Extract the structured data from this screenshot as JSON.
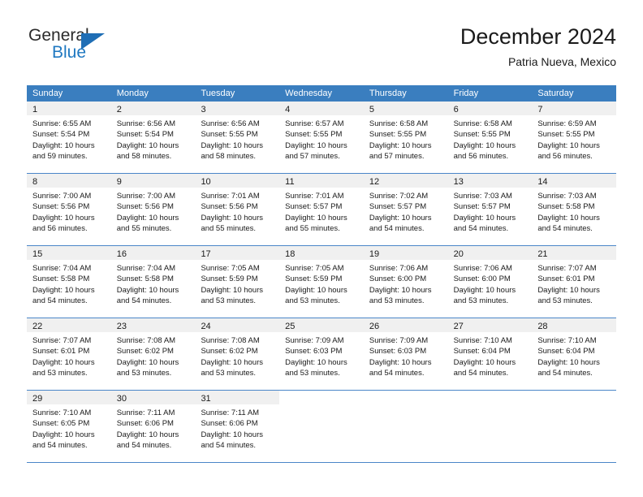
{
  "brand": {
    "name_line1": "General",
    "name_line2": "Blue",
    "accent_color": "#1f78c1",
    "logo_triangle_color": "#1f6eb5"
  },
  "header": {
    "month_title": "December 2024",
    "location": "Patria Nueva, Mexico"
  },
  "calendar": {
    "header_bg": "#3a7ebf",
    "day_band_bg": "#f0f0f0",
    "weekdays": [
      "Sunday",
      "Monday",
      "Tuesday",
      "Wednesday",
      "Thursday",
      "Friday",
      "Saturday"
    ],
    "weeks": [
      [
        {
          "day": "1",
          "sunrise": "Sunrise: 6:55 AM",
          "sunset": "Sunset: 5:54 PM",
          "daylight1": "Daylight: 10 hours",
          "daylight2": "and 59 minutes."
        },
        {
          "day": "2",
          "sunrise": "Sunrise: 6:56 AM",
          "sunset": "Sunset: 5:54 PM",
          "daylight1": "Daylight: 10 hours",
          "daylight2": "and 58 minutes."
        },
        {
          "day": "3",
          "sunrise": "Sunrise: 6:56 AM",
          "sunset": "Sunset: 5:55 PM",
          "daylight1": "Daylight: 10 hours",
          "daylight2": "and 58 minutes."
        },
        {
          "day": "4",
          "sunrise": "Sunrise: 6:57 AM",
          "sunset": "Sunset: 5:55 PM",
          "daylight1": "Daylight: 10 hours",
          "daylight2": "and 57 minutes."
        },
        {
          "day": "5",
          "sunrise": "Sunrise: 6:58 AM",
          "sunset": "Sunset: 5:55 PM",
          "daylight1": "Daylight: 10 hours",
          "daylight2": "and 57 minutes."
        },
        {
          "day": "6",
          "sunrise": "Sunrise: 6:58 AM",
          "sunset": "Sunset: 5:55 PM",
          "daylight1": "Daylight: 10 hours",
          "daylight2": "and 56 minutes."
        },
        {
          "day": "7",
          "sunrise": "Sunrise: 6:59 AM",
          "sunset": "Sunset: 5:55 PM",
          "daylight1": "Daylight: 10 hours",
          "daylight2": "and 56 minutes."
        }
      ],
      [
        {
          "day": "8",
          "sunrise": "Sunrise: 7:00 AM",
          "sunset": "Sunset: 5:56 PM",
          "daylight1": "Daylight: 10 hours",
          "daylight2": "and 56 minutes."
        },
        {
          "day": "9",
          "sunrise": "Sunrise: 7:00 AM",
          "sunset": "Sunset: 5:56 PM",
          "daylight1": "Daylight: 10 hours",
          "daylight2": "and 55 minutes."
        },
        {
          "day": "10",
          "sunrise": "Sunrise: 7:01 AM",
          "sunset": "Sunset: 5:56 PM",
          "daylight1": "Daylight: 10 hours",
          "daylight2": "and 55 minutes."
        },
        {
          "day": "11",
          "sunrise": "Sunrise: 7:01 AM",
          "sunset": "Sunset: 5:57 PM",
          "daylight1": "Daylight: 10 hours",
          "daylight2": "and 55 minutes."
        },
        {
          "day": "12",
          "sunrise": "Sunrise: 7:02 AM",
          "sunset": "Sunset: 5:57 PM",
          "daylight1": "Daylight: 10 hours",
          "daylight2": "and 54 minutes."
        },
        {
          "day": "13",
          "sunrise": "Sunrise: 7:03 AM",
          "sunset": "Sunset: 5:57 PM",
          "daylight1": "Daylight: 10 hours",
          "daylight2": "and 54 minutes."
        },
        {
          "day": "14",
          "sunrise": "Sunrise: 7:03 AM",
          "sunset": "Sunset: 5:58 PM",
          "daylight1": "Daylight: 10 hours",
          "daylight2": "and 54 minutes."
        }
      ],
      [
        {
          "day": "15",
          "sunrise": "Sunrise: 7:04 AM",
          "sunset": "Sunset: 5:58 PM",
          "daylight1": "Daylight: 10 hours",
          "daylight2": "and 54 minutes."
        },
        {
          "day": "16",
          "sunrise": "Sunrise: 7:04 AM",
          "sunset": "Sunset: 5:58 PM",
          "daylight1": "Daylight: 10 hours",
          "daylight2": "and 54 minutes."
        },
        {
          "day": "17",
          "sunrise": "Sunrise: 7:05 AM",
          "sunset": "Sunset: 5:59 PM",
          "daylight1": "Daylight: 10 hours",
          "daylight2": "and 53 minutes."
        },
        {
          "day": "18",
          "sunrise": "Sunrise: 7:05 AM",
          "sunset": "Sunset: 5:59 PM",
          "daylight1": "Daylight: 10 hours",
          "daylight2": "and 53 minutes."
        },
        {
          "day": "19",
          "sunrise": "Sunrise: 7:06 AM",
          "sunset": "Sunset: 6:00 PM",
          "daylight1": "Daylight: 10 hours",
          "daylight2": "and 53 minutes."
        },
        {
          "day": "20",
          "sunrise": "Sunrise: 7:06 AM",
          "sunset": "Sunset: 6:00 PM",
          "daylight1": "Daylight: 10 hours",
          "daylight2": "and 53 minutes."
        },
        {
          "day": "21",
          "sunrise": "Sunrise: 7:07 AM",
          "sunset": "Sunset: 6:01 PM",
          "daylight1": "Daylight: 10 hours",
          "daylight2": "and 53 minutes."
        }
      ],
      [
        {
          "day": "22",
          "sunrise": "Sunrise: 7:07 AM",
          "sunset": "Sunset: 6:01 PM",
          "daylight1": "Daylight: 10 hours",
          "daylight2": "and 53 minutes."
        },
        {
          "day": "23",
          "sunrise": "Sunrise: 7:08 AM",
          "sunset": "Sunset: 6:02 PM",
          "daylight1": "Daylight: 10 hours",
          "daylight2": "and 53 minutes."
        },
        {
          "day": "24",
          "sunrise": "Sunrise: 7:08 AM",
          "sunset": "Sunset: 6:02 PM",
          "daylight1": "Daylight: 10 hours",
          "daylight2": "and 53 minutes."
        },
        {
          "day": "25",
          "sunrise": "Sunrise: 7:09 AM",
          "sunset": "Sunset: 6:03 PM",
          "daylight1": "Daylight: 10 hours",
          "daylight2": "and 53 minutes."
        },
        {
          "day": "26",
          "sunrise": "Sunrise: 7:09 AM",
          "sunset": "Sunset: 6:03 PM",
          "daylight1": "Daylight: 10 hours",
          "daylight2": "and 54 minutes."
        },
        {
          "day": "27",
          "sunrise": "Sunrise: 7:10 AM",
          "sunset": "Sunset: 6:04 PM",
          "daylight1": "Daylight: 10 hours",
          "daylight2": "and 54 minutes."
        },
        {
          "day": "28",
          "sunrise": "Sunrise: 7:10 AM",
          "sunset": "Sunset: 6:04 PM",
          "daylight1": "Daylight: 10 hours",
          "daylight2": "and 54 minutes."
        }
      ],
      [
        {
          "day": "29",
          "sunrise": "Sunrise: 7:10 AM",
          "sunset": "Sunset: 6:05 PM",
          "daylight1": "Daylight: 10 hours",
          "daylight2": "and 54 minutes."
        },
        {
          "day": "30",
          "sunrise": "Sunrise: 7:11 AM",
          "sunset": "Sunset: 6:06 PM",
          "daylight1": "Daylight: 10 hours",
          "daylight2": "and 54 minutes."
        },
        {
          "day": "31",
          "sunrise": "Sunrise: 7:11 AM",
          "sunset": "Sunset: 6:06 PM",
          "daylight1": "Daylight: 10 hours",
          "daylight2": "and 54 minutes."
        },
        {
          "day": "",
          "sunrise": "",
          "sunset": "",
          "daylight1": "",
          "daylight2": ""
        },
        {
          "day": "",
          "sunrise": "",
          "sunset": "",
          "daylight1": "",
          "daylight2": ""
        },
        {
          "day": "",
          "sunrise": "",
          "sunset": "",
          "daylight1": "",
          "daylight2": ""
        },
        {
          "day": "",
          "sunrise": "",
          "sunset": "",
          "daylight1": "",
          "daylight2": ""
        }
      ]
    ]
  }
}
